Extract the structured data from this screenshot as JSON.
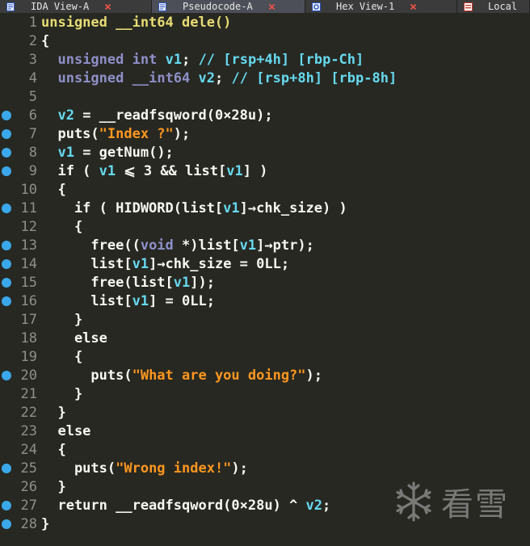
{
  "tabs": [
    {
      "label": "IDA View-A",
      "icon": "ida-view-icon",
      "active": false,
      "closable": true
    },
    {
      "label": "Pseudocode-A",
      "icon": "pseudocode-icon",
      "active": true,
      "closable": true
    },
    {
      "label": "Hex View-1",
      "icon": "hex-view-icon",
      "active": false,
      "closable": true
    },
    {
      "label": "Local",
      "icon": "local-types-icon",
      "active": false,
      "closable": false
    }
  ],
  "colors": {
    "background": "#272822",
    "breakpoint": "#3aa8ea",
    "string": "#fd971f",
    "keyword_type": "#8f8fc8",
    "identifier_highlight": "#66d9ef",
    "line_number": "#8f908a",
    "close_icon": "#e8504a"
  },
  "code": {
    "lines": [
      {
        "num": "1",
        "bp": false,
        "text": "unsigned __int64 dele()"
      },
      {
        "num": "2",
        "bp": false,
        "text": "{"
      },
      {
        "num": "3",
        "bp": false,
        "text": "  unsigned int v1; // [rsp+4h] [rbp-Ch]"
      },
      {
        "num": "4",
        "bp": false,
        "text": "  unsigned __int64 v2; // [rsp+8h] [rbp-8h]"
      },
      {
        "num": "5",
        "bp": false,
        "text": ""
      },
      {
        "num": "6",
        "bp": true,
        "text": "  v2 = __readfsqword(0×28u);"
      },
      {
        "num": "7",
        "bp": true,
        "text": "  puts(\"Index ?\");"
      },
      {
        "num": "8",
        "bp": true,
        "text": "  v1 = getNum();"
      },
      {
        "num": "9",
        "bp": true,
        "text": "  if ( v1 ⩽ 3 && list[v1] )"
      },
      {
        "num": "10",
        "bp": false,
        "text": "  {"
      },
      {
        "num": "11",
        "bp": true,
        "text": "    if ( HIDWORD(list[v1]→chk_size) )"
      },
      {
        "num": "12",
        "bp": false,
        "text": "    {"
      },
      {
        "num": "13",
        "bp": true,
        "text": "      free((void *)list[v1]→ptr);"
      },
      {
        "num": "14",
        "bp": true,
        "text": "      list[v1]→chk_size = 0LL;"
      },
      {
        "num": "15",
        "bp": true,
        "text": "      free(list[v1]);"
      },
      {
        "num": "16",
        "bp": true,
        "text": "      list[v1] = 0LL;"
      },
      {
        "num": "17",
        "bp": false,
        "text": "    }"
      },
      {
        "num": "18",
        "bp": false,
        "text": "    else"
      },
      {
        "num": "19",
        "bp": false,
        "text": "    {"
      },
      {
        "num": "20",
        "bp": true,
        "text": "      puts(\"What are you doing?\");"
      },
      {
        "num": "21",
        "bp": false,
        "text": "    }"
      },
      {
        "num": "22",
        "bp": false,
        "text": "  }"
      },
      {
        "num": "23",
        "bp": false,
        "text": "  else"
      },
      {
        "num": "24",
        "bp": false,
        "text": "  {"
      },
      {
        "num": "25",
        "bp": true,
        "text": "    puts(\"Wrong index!\");"
      },
      {
        "num": "26",
        "bp": false,
        "text": "  }"
      },
      {
        "num": "27",
        "bp": true,
        "text": "  return __readfsqword(0×28u) ^ v2;"
      },
      {
        "num": "28",
        "bp": true,
        "text": "}"
      }
    ]
  },
  "watermark": {
    "text": "看雪",
    "icon": "snowflake-icon"
  }
}
